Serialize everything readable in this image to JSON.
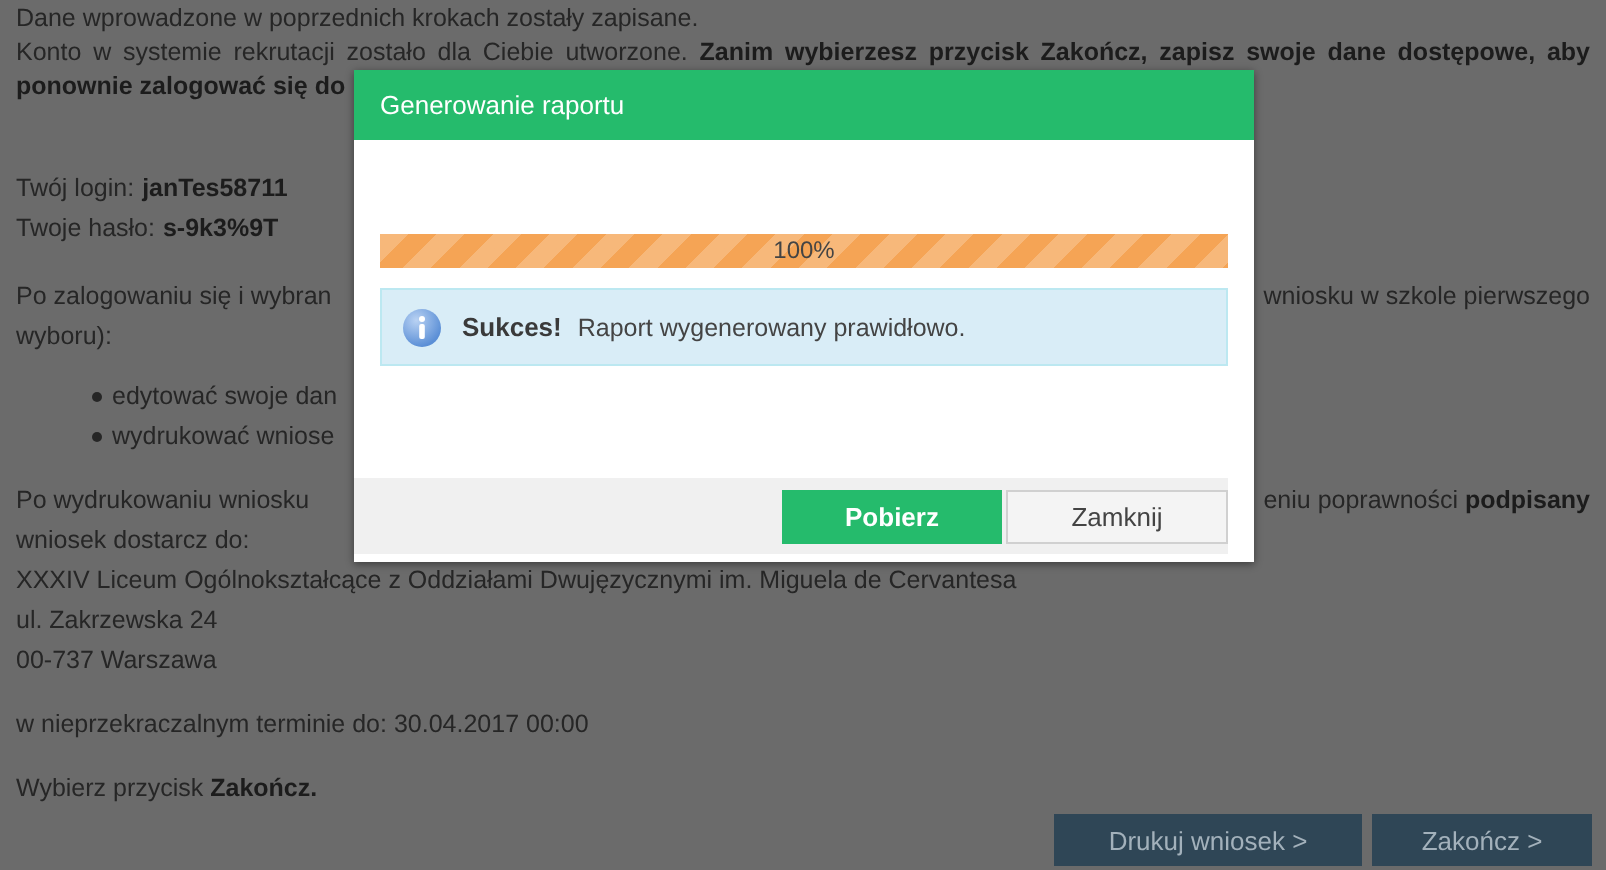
{
  "page": {
    "paragraphs": [
      {
        "kind": "text",
        "lines": [
          {
            "kind": "plain",
            "text": "Dane wprowadzone w poprzednich krokach zostały zapisane."
          },
          {
            "kind": "justified",
            "text": "Konto w systemie rekrutacji zostało dla Ciebie utworzone. **Zanim wybierzesz przycisk Zakończ, zapisz swoje dane dostępowe, aby**"
          },
          {
            "kind": "strong",
            "text": "ponownie zalogować się do"
          }
        ]
      },
      {
        "kind": "text",
        "lines": [
          {
            "kind": "field",
            "label": "Twój login:",
            "value": "janTes58711"
          },
          {
            "kind": "field",
            "label": "Twoje hasło:",
            "value": "s-9k3%9T"
          }
        ]
      },
      {
        "kind": "text",
        "lines": [
          {
            "kind": "split",
            "left": "Po zalogowaniu się i wybran",
            "right": "wniosku w szkole pierwszego"
          },
          {
            "kind": "plain",
            "text": "wyboru):"
          }
        ]
      },
      {
        "kind": "list",
        "lines": [
          {
            "kind": "plain",
            "text": "edytować swoje dan"
          },
          {
            "kind": "plain",
            "text": "wydrukować wniose"
          }
        ]
      },
      {
        "kind": "text",
        "lines": [
          {
            "kind": "split",
            "left": "Po wydrukowaniu wniosku",
            "right": "eniu poprawności **podpisany**"
          },
          {
            "kind": "plain",
            "text": "wniosek dostarcz do:"
          },
          {
            "kind": "plain",
            "text": "XXXIV Liceum Ogólnokształcące z Oddziałami Dwujęzycznymi im. Miguela de Cervantesa"
          },
          {
            "kind": "plain",
            "text": "ul. Zakrzewska 24"
          },
          {
            "kind": "plain",
            "text": "00-737 Warszawa"
          }
        ]
      },
      {
        "kind": "text",
        "lines": [
          {
            "kind": "plain",
            "text": "w nieprzekraczalnym terminie do: 30.04.2017 00:00"
          }
        ]
      },
      {
        "kind": "text",
        "lines": [
          {
            "kind": "plain",
            "text": "Wybierz przycisk **Zakończ.**"
          }
        ]
      }
    ],
    "buttons": [
      "Drukuj wniosek >",
      "Zakończ >"
    ]
  },
  "dialog": {
    "title": "Generowanie raportu",
    "progress": {
      "level": 1,
      "label": "100%"
    },
    "alert": {
      "title": "Sukces!",
      "message": "Raport wygenerowany prawidłowo."
    },
    "buttons": [
      {
        "label": "Pobierz",
        "kind": "primary"
      },
      {
        "label": "Zamknij",
        "kind": "default"
      }
    ]
  }
}
